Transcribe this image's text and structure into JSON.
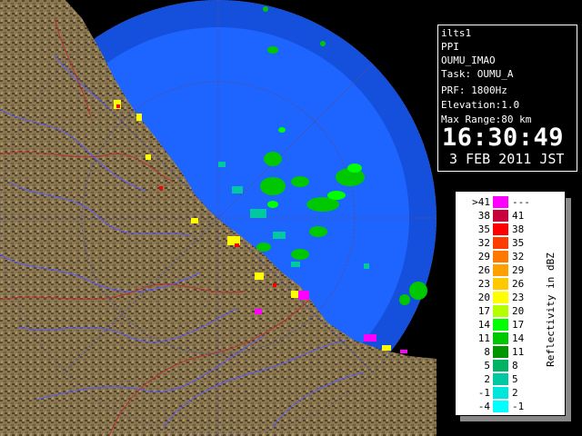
{
  "info": {
    "station": "ilts1",
    "scan_type": "PPI",
    "site": "OUMU_IMAO",
    "task": "Task: OUMU_A",
    "prf": "PRF: 1800Hz",
    "elevation": "Elevation:1.0",
    "max_range": "Max Range:80 km",
    "time": "16:30:49",
    "date": "3 FEB 2011 JST"
  },
  "legend": {
    "title": "Reflectivity in dBZ",
    "rows": [
      {
        "lo": ">41",
        "hi": "---",
        "color": "#ff00ff"
      },
      {
        "lo": "38",
        "hi": "41",
        "color": "#c8003c"
      },
      {
        "lo": "35",
        "hi": "38",
        "color": "#ff0000"
      },
      {
        "lo": "32",
        "hi": "35",
        "color": "#ff3c00"
      },
      {
        "lo": "29",
        "hi": "32",
        "color": "#ff7800"
      },
      {
        "lo": "26",
        "hi": "29",
        "color": "#ffa000"
      },
      {
        "lo": "23",
        "hi": "26",
        "color": "#ffc800"
      },
      {
        "lo": "20",
        "hi": "23",
        "color": "#ffff00"
      },
      {
        "lo": "17",
        "hi": "20",
        "color": "#b4ff00"
      },
      {
        "lo": "14",
        "hi": "17",
        "color": "#00ff00"
      },
      {
        "lo": "11",
        "hi": "14",
        "color": "#00c800"
      },
      {
        "lo": "8",
        "hi": "11",
        "color": "#009600"
      },
      {
        "lo": "5",
        "hi": "8",
        "color": "#00b464"
      },
      {
        "lo": "2",
        "hi": "5",
        "color": "#00c8a0"
      },
      {
        "lo": "-1",
        "hi": "2",
        "color": "#00e6dc"
      },
      {
        "lo": "-4",
        "hi": "-1",
        "color": "#00ffff"
      }
    ]
  },
  "colors": {
    "sea": "#1e64ff",
    "sea_outer": "#1450dc",
    "land": "#8c7850",
    "land_dark": "#5a4a30",
    "rivers": "#5a5aff",
    "boundaries": "#b43232",
    "range_rings": "#50509a"
  }
}
